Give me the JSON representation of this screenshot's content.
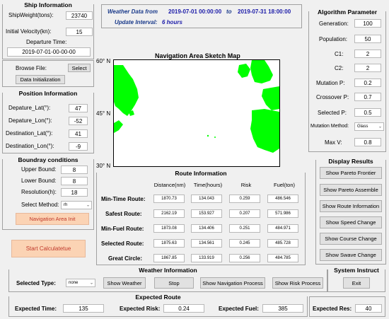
{
  "ship": {
    "title": "Ship Information",
    "weight_label": "ShipWeight(tons)​:",
    "weight_value": "23740",
    "velocity_label": "Initial Velocity(kn)​:",
    "velocity_value": "15",
    "departure_time_label": "Departure Time​:",
    "departure_time_value": "2019-07-01-00-00-00"
  },
  "file": {
    "browse_label": "Browse File​:",
    "select_label": "Select",
    "init_label": "Data Initialization"
  },
  "position": {
    "title": "Position Information",
    "dep_lat_label": "Depature_Lat(°)​:",
    "dep_lat_value": "47",
    "dep_lon_label": "Depature_Lon(°)​:",
    "dep_lon_value": "-52",
    "dest_lat_label": "Destination_Lat(°)​:",
    "dest_lat_value": "41",
    "dest_lon_label": "Destination_Lon(°)​:",
    "dest_lon_value": "-9"
  },
  "boundary": {
    "title": "Boundray conditions",
    "upper_label": "Upper Bound​:",
    "upper_value": "8",
    "lower_label": "Lower Bound​:",
    "lower_value": "8",
    "resolution_label": "Resolution(h)​:",
    "resolution_value": "18",
    "method_label": "Select Method​:",
    "method_value": "rh",
    "nav_area_label": "Navigation Area Init"
  },
  "start_label": "Start Calculatetue",
  "weather_header": {
    "from_label": "Weather Data from",
    "from_value": "2019-07-01 00:00:00",
    "to_label": "to",
    "to_value": "2019-07-31 18:00:00",
    "interval_label": "Update Interval:",
    "interval_value": "6 hours"
  },
  "map": {
    "title": "Navigation Area Sketch Map",
    "lat_top": "60° N",
    "lat_mid": "45° N",
    "lat_bot": "30° N",
    "land_color": "#00ff00"
  },
  "route": {
    "title": "Route Information",
    "headers": [
      "Distance(nm)",
      "Time(hours)",
      "Risk",
      "Fuel(ton)"
    ],
    "rows": [
      {
        "label": "Min-Time Route​:",
        "values": [
          "1870.73",
          "134.043",
          "0.259",
          "486.546"
        ]
      },
      {
        "label": "Safest Route​:",
        "values": [
          "2162.19",
          "153.927",
          "0.207",
          "571.986"
        ]
      },
      {
        "label": "Min-Fuel Route​:",
        "values": [
          "1873.08",
          "134.406",
          "0.251",
          "484.971"
        ]
      },
      {
        "label": "Selected Route​:",
        "values": [
          "1875.63",
          "134.561",
          "0.245",
          "485.728"
        ]
      },
      {
        "label": "Great Circle​:",
        "values": [
          "1867.85",
          "133.919",
          "0.256",
          "484.785"
        ]
      }
    ]
  },
  "algorithm": {
    "title": "Algorithm Parameter",
    "generation_label": "Generation:",
    "generation_value": "100",
    "population_label": "Population:",
    "population_value": "50",
    "c1_label": "C1:",
    "c1_value": "2",
    "c2_label": "C2:",
    "c2_value": "2",
    "mutation_label": "Mutation P:",
    "mutation_value": "0.2",
    "crossover_label": "Crossover P:",
    "crossover_value": "0.7",
    "selected_label": "Selected P:",
    "selected_value": "0.5",
    "method_label": "Mutation Method:",
    "method_value": "Glass",
    "maxv_label": "Max V:",
    "maxv_value": "0.8"
  },
  "display": {
    "title": "Display Results",
    "buttons": [
      "Show Pareto Frontier",
      "Show Pareto Assemble",
      "Show Route Information",
      "Show Speed Change",
      "Show Course Change",
      "Show Swave Change"
    ]
  },
  "weather": {
    "title": "Weather Information",
    "type_label": "Selected Type:",
    "type_value": "none",
    "show_weather": "Show Weather",
    "stop": "Stop",
    "show_nav": "Show Navigation Process",
    "show_risk": "Show Risk Process"
  },
  "system": {
    "title": "System Instruct",
    "exit": "Exit"
  },
  "expected": {
    "title": "Expected Route",
    "time_label": "Expected Time:",
    "time_value": "135",
    "risk_label": "Expected Risk:",
    "risk_value": "0.24",
    "fuel_label": "Expected Fuel:",
    "fuel_value": "385",
    "res_label": "Expected Res:",
    "res_value": "40"
  }
}
